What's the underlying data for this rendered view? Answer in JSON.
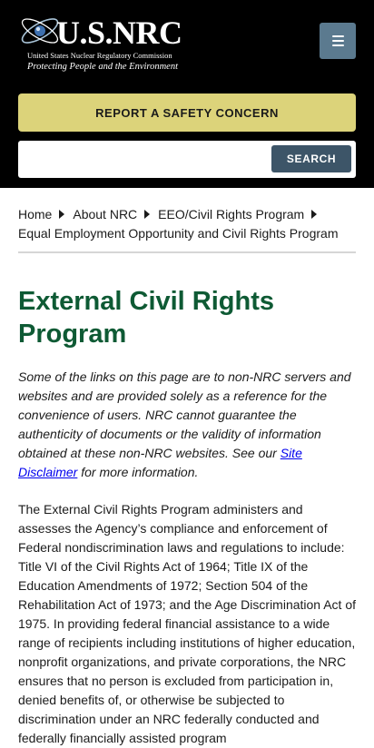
{
  "header": {
    "logo_text": "U.S.NRC",
    "logo_subtitle": "United States Nuclear Regulatory Commission",
    "logo_tagline": "Protecting People and the Environment",
    "menu_icon": "menu-icon"
  },
  "report": {
    "label": "REPORT A SAFETY CONCERN"
  },
  "search": {
    "value": "",
    "placeholder": "",
    "button_label": "SEARCH"
  },
  "breadcrumb": {
    "items": [
      "Home",
      "About NRC",
      "EEO/Civil Rights Program",
      "Equal Employment Opportunity and Civil Rights Program"
    ]
  },
  "page": {
    "title": "External Civil Rights Program",
    "disclaimer_before": "Some of the links on this page are to non-NRC servers and websites and are provided solely as a reference for the convenience of users. NRC cannot guarantee the authenticity of documents or the validity of information obtained at these non-NRC websites. See our ",
    "disclaimer_link": "Site Disclaimer",
    "disclaimer_after": " for more information.",
    "body": "The External Civil Rights Program administers and assesses the Agency’s compliance and enforcement of Federal nondiscrimination laws and regulations to include: Title VI of the Civil Rights Act of 1964; Title IX of the Education Amendments of 1972; Section 504 of the Rehabilitation Act of 1973; and the Age Discrimination Act of 1975. In providing federal financial assistance to a wide range of recipients including institutions of higher education, nonprofit organizations, and private corporations, the NRC ensures that no person is excluded from participation in, denied benefits of, or otherwise be subjected to discrimination under an NRC federally conducted and federally financially assisted program"
  },
  "colors": {
    "header_bg": "#000000",
    "report_bg": "#dcd37a",
    "search_btn_bg": "#3d5568",
    "menu_btn_bg": "#5b7a8f",
    "title": "#0e5a34",
    "link": "#0000ee"
  }
}
